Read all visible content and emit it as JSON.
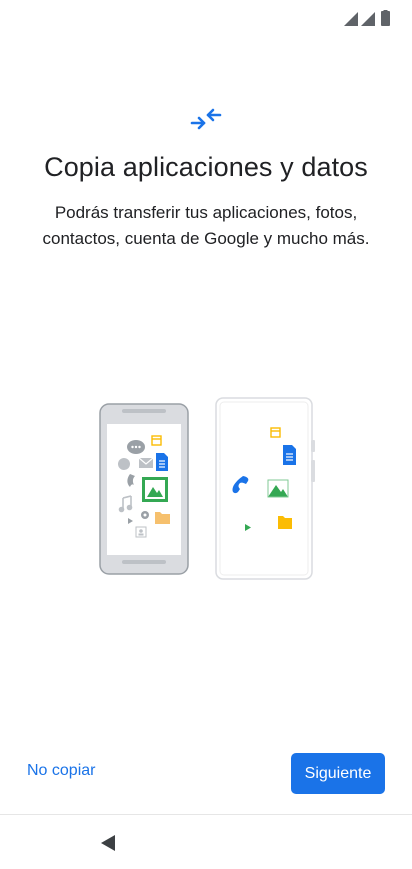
{
  "status_bar": {
    "icons": [
      "signal-icon",
      "signal-icon",
      "battery-icon"
    ]
  },
  "header": {
    "icon": "transfer-arrows-icon",
    "title": "Copia aplicaciones y datos",
    "subtitle_line1": "Podrás transferir tus aplicaciones, fotos,",
    "subtitle_line2": "contactos, cuenta de Google y mucho más."
  },
  "illustration": {
    "left_phone_icons": [
      "message-icon",
      "calendar-icon",
      "mail-icon",
      "document-icon",
      "phone-icon",
      "photos-icon",
      "music-icon",
      "settings-icon",
      "folder-icon",
      "play-icon",
      "contact-icon"
    ],
    "right_phone_icons": [
      "calendar-icon",
      "document-icon",
      "phone-icon",
      "photos-icon",
      "play-icon",
      "folder-icon"
    ]
  },
  "footer": {
    "skip_label": "No copiar",
    "next_label": "Siguiente"
  },
  "nav_bar": {
    "back_icon": "back-triangle-icon"
  },
  "colors": {
    "accent": "#1a73e8",
    "text": "#202124",
    "phone_gray": "#dadce0"
  }
}
